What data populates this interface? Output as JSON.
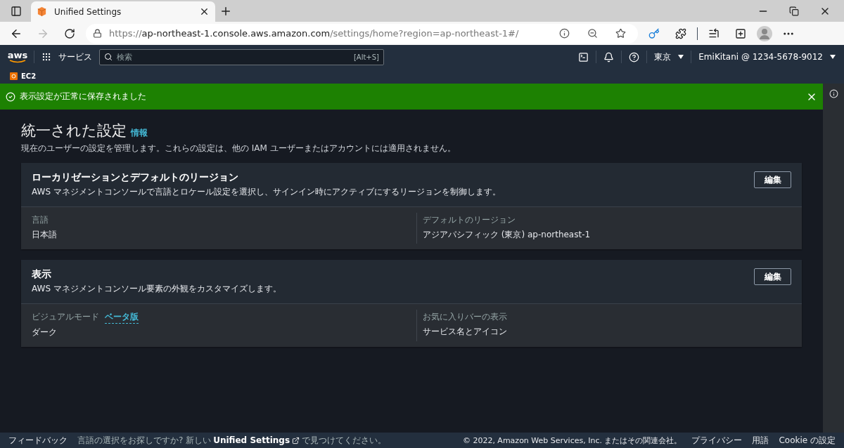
{
  "browser": {
    "tab": {
      "title": "Unified Settings",
      "selected": true
    },
    "url": {
      "scheme": "https://",
      "host": "ap-northeast-1.console.aws.amazon.com",
      "path": "/settings/home?region=ap-northeast-1#/"
    }
  },
  "console_nav": {
    "logo": "aws",
    "services": "サービス",
    "search": {
      "placeholder": "検索",
      "shortcut": "[Alt+S]"
    },
    "region": "東京",
    "account": "EmiKitani @ 1234-5678-9012"
  },
  "favorites": [
    {
      "label": "EC2"
    }
  ],
  "flash": {
    "message": "表示設定が正常に保存されました"
  },
  "page": {
    "title": "統一された設定",
    "info": "情報",
    "description": "現在のユーザーの設定を管理します。これらの設定は、他の IAM ユーザーまたはアカウントには適用されません。"
  },
  "sections": [
    {
      "title": "ローカリゼーションとデフォルトのリージョン",
      "description": "AWS マネジメントコンソールで言語とロケール設定を選択し、サインイン時にアクティブにするリージョンを制御します。",
      "button": "編集",
      "fields": [
        {
          "label": "言語",
          "value": "日本語"
        },
        {
          "label": "デフォルトのリージョン",
          "value": "アジアパシフィック (東京) ap-northeast-1"
        }
      ]
    },
    {
      "title": "表示",
      "description": "AWS マネジメントコンソール要素の外観をカスタマイズします。",
      "button": "編集",
      "fields": [
        {
          "label": "ビジュアルモード",
          "badge": "ベータ版",
          "value": "ダーク"
        },
        {
          "label": "お気に入りバーの表示",
          "value": "サービス名とアイコン"
        }
      ]
    }
  ],
  "footer": {
    "feedback": "フィードバック",
    "notice_before": "言語の選択をお探しですか? 新しい",
    "notice_link": "Unified Settings",
    "notice_after": "で見つけてください。",
    "copyright": "© 2022, Amazon Web Services, Inc. またはその関連会社。",
    "links": [
      "プライバシー",
      "用語",
      "Cookie の設定"
    ]
  }
}
